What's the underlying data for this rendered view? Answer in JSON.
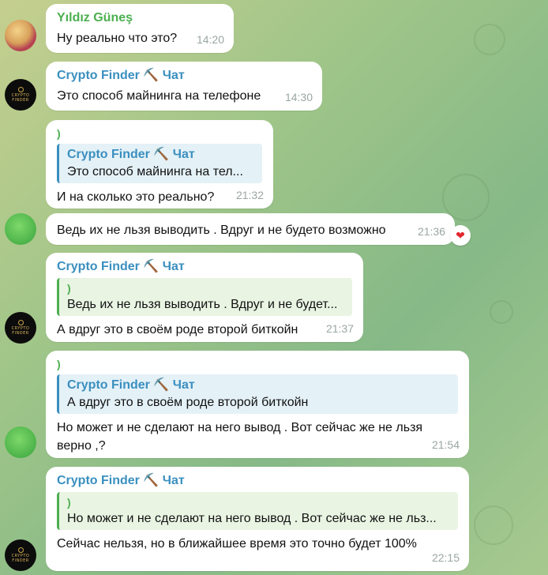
{
  "messages": [
    {
      "sender": "Yıldız Güneş",
      "text": "Ну реально что это?",
      "time": "14:20"
    },
    {
      "sender": "Crypto Finder ⛏️ Чат",
      "text": "Это способ майнинга на телефоне",
      "time": "14:30"
    },
    {
      "pre": ")",
      "quote_sender": "Crypto Finder ⛏️ Чат",
      "quote_text": "Это способ майнинга на тел...",
      "text": "И на сколько это реально?",
      "time": "21:32"
    },
    {
      "text": "Ведь их не льзя выводить . Вдруг и не будето возможно",
      "time": "21:36",
      "reaction": "❤"
    },
    {
      "sender": "Crypto Finder ⛏️ Чат",
      "quote_pre": ")",
      "quote_text": "Ведь их не льзя выводить . Вдруг и не будет...",
      "text": "А вдруг это в своём роде второй биткойн",
      "time": "21:37"
    },
    {
      "pre": ")",
      "quote_sender": "Crypto Finder ⛏️ Чат",
      "quote_text": "А вдруг это в своём роде второй биткойн",
      "text": "Но может и не сделают на него вывод . Вот сейчас же не льзя верно ,?",
      "time": "21:54"
    },
    {
      "sender": "Crypto Finder ⛏️ Чат",
      "quote_pre": ")",
      "quote_text": "Но может и не сделают на него вывод . Вот сейчас же не льз...",
      "text": "Сейчас нельзя, но в ближайшее время это точно будет 100%",
      "time": "22:15"
    }
  ],
  "avatar_logo_text": "CRYPTO FINDER"
}
